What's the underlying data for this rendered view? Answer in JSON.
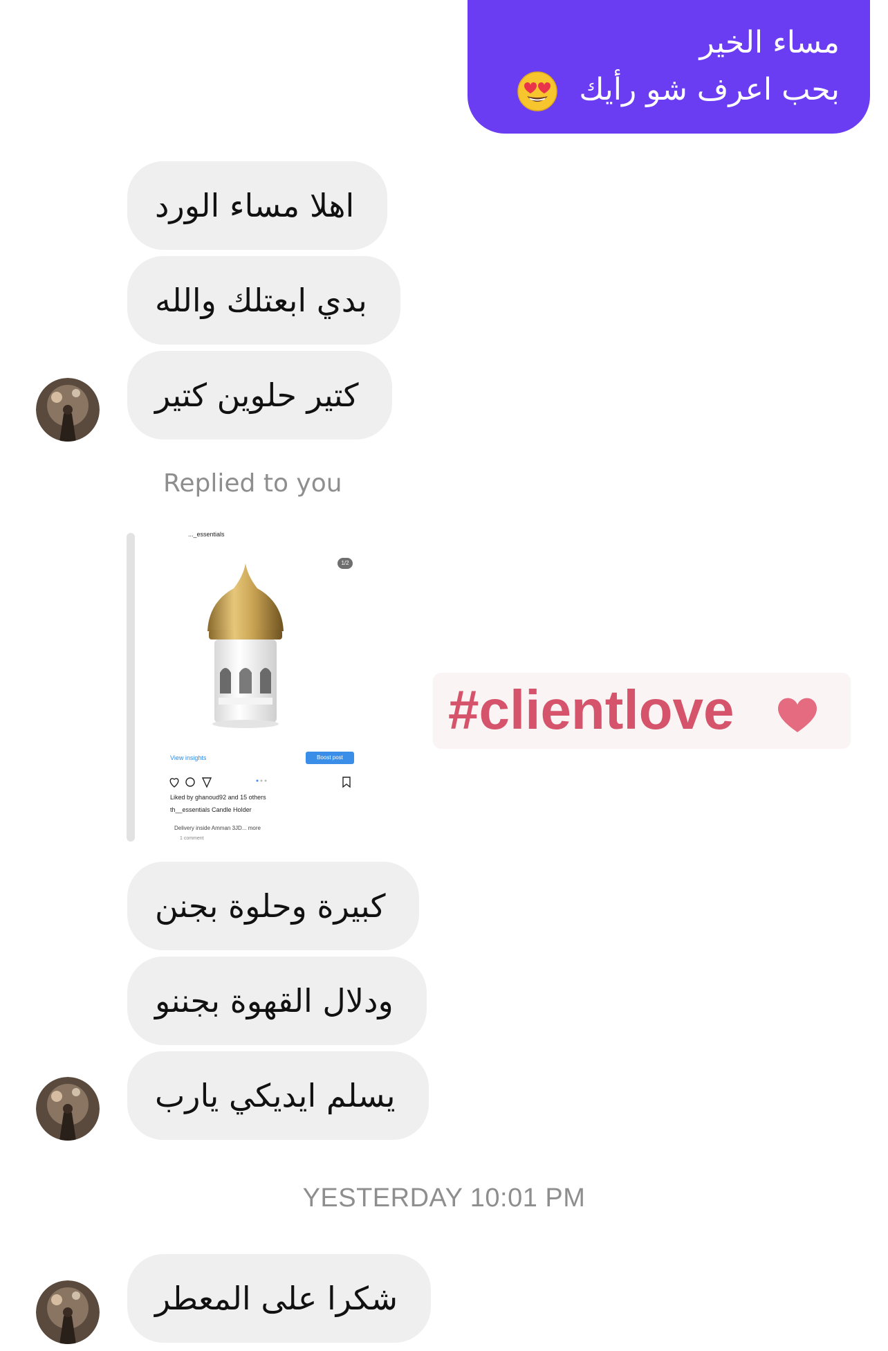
{
  "sent_message": {
    "line1": "مساء الخير",
    "line2": "بحب اعرف شو  رأيك",
    "emoji_icon": "heart-eyes-emoji-icon",
    "bubble_color": "#6a3cf2"
  },
  "received_group_1": [
    "اهلا مساء الورد",
    "بدي ابعتلك والله",
    "كتير حلوين كتير"
  ],
  "reply": {
    "label": "Replied to you",
    "story": {
      "username": "..._essentials",
      "counter": "1/2",
      "view_insights": "View insights",
      "boost_post": "Boost post",
      "liked_by": "Liked by ghanoud92 and 15 others",
      "caption": "th__essentials Candle Holder",
      "description": "Delivery inside Amman 3JD... more",
      "comments": "1 comment"
    }
  },
  "sticker": {
    "text": "#clientlove",
    "icon": "heart-icon",
    "color": "#d5546b"
  },
  "received_group_2": [
    "كبيرة وحلوة بجنن",
    "ودلال القهوة بجننو",
    "يسلم ايديكي يارب"
  ],
  "timestamp": "YESTERDAY 10:01 PM",
  "received_group_3": [
    "شكرا على المعطر"
  ]
}
